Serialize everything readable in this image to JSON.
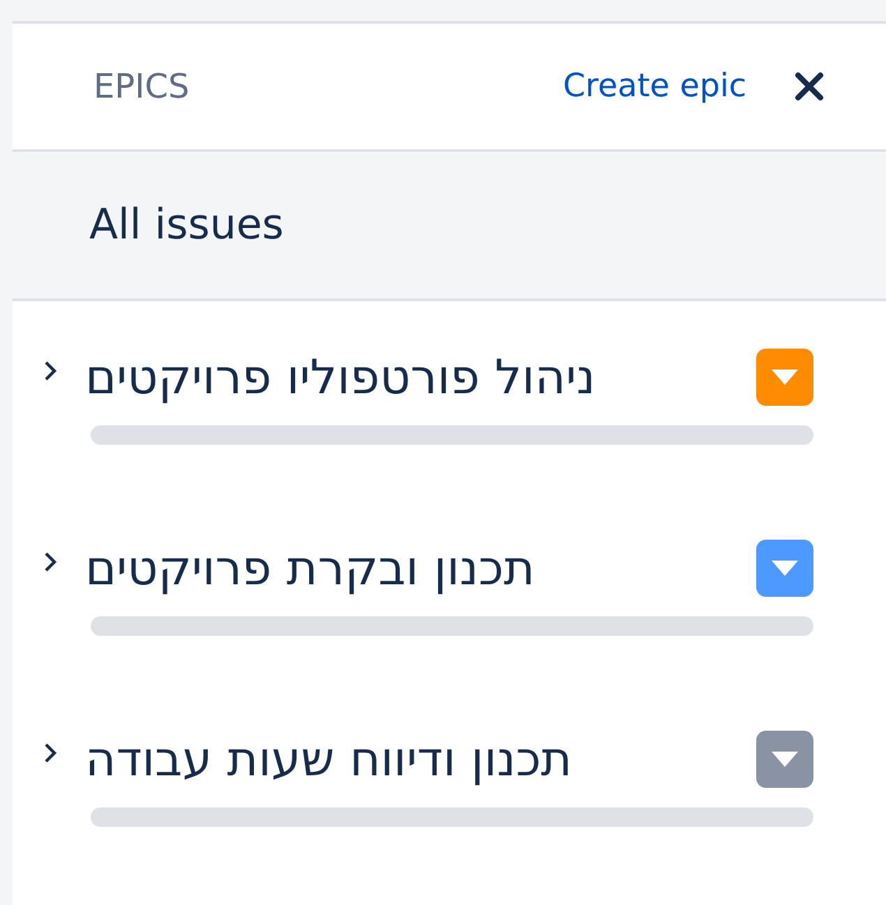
{
  "panel": {
    "title": "EPICS",
    "create_link": "Create epic"
  },
  "all_issues": {
    "label": "All issues"
  },
  "epics": [
    {
      "name": "ניהול פורטפוליו פרויקטים",
      "color": "#ff8b00",
      "level": 0
    },
    {
      "name": "תכנון ובקרת פרויקטים",
      "color": "#4c9aff",
      "level": 0
    },
    {
      "name": "תכנון ודיווח שעות עבודה",
      "color": "#8993a4",
      "level": 0
    }
  ]
}
